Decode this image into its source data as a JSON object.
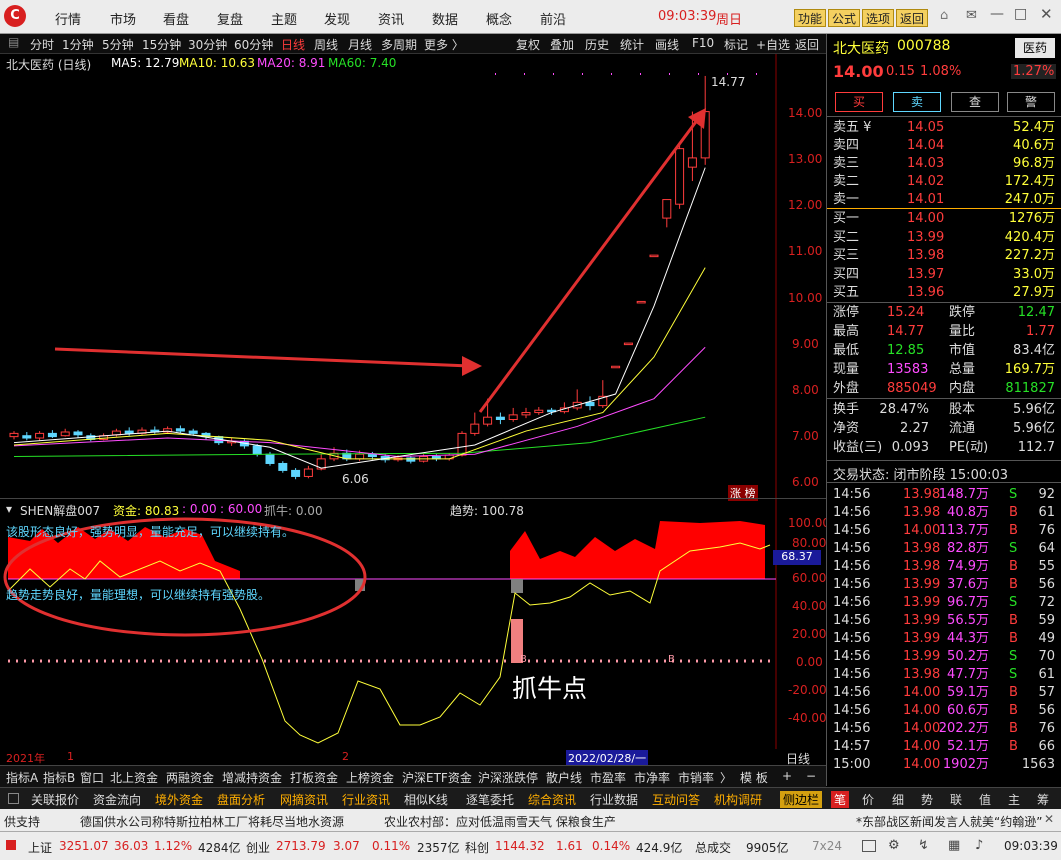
{
  "topbar": {
    "logo": "C",
    "menu": [
      "行情",
      "市场",
      "看盘",
      "复盘",
      "主题",
      "发现",
      "资讯",
      "数据",
      "概念",
      "前沿"
    ],
    "time": "09:03:39",
    "weekday": "周日",
    "buttons": [
      "功能",
      "公式",
      "选项",
      "返回"
    ]
  },
  "periodbar": {
    "periods": [
      "分时",
      "1分钟",
      "5分钟",
      "15分钟",
      "30分钟",
      "60分钟",
      "日线",
      "周线",
      "月线",
      "多周期",
      "更多 〉"
    ],
    "active": "日线",
    "tools": [
      "复权",
      "叠加",
      "历史",
      "统计",
      "画线",
      "F10",
      "标记",
      "+自选",
      "返回"
    ]
  },
  "mainchart": {
    "title": "北大医药 (日线)",
    "ma": [
      "MA5: 12.79",
      "MA10: 10.63",
      "MA20: 8.91",
      "MA60: 7.40"
    ],
    "high_label": "14.77",
    "low_label": "6.06",
    "badge": "涨 榜",
    "annotation": "抓牛点",
    "y_ticks": [
      "14.00",
      "13.00",
      "12.00",
      "11.00",
      "10.00",
      "9.00",
      "8.00",
      "7.00",
      "6.00"
    ]
  },
  "indicator": {
    "name": "SHEN解盘007",
    "fund": "资金: 80.83",
    "v1": ": 0.00",
    "v2": ": 60.00",
    "bull": "抓牛: 0.00",
    "trend": "趋势: 100.78",
    "msg1": "该股形态良好，强势明显，量能充足，可以继续持有。",
    "msg2": "趋势走势良好，量能理想，可以继续持有强势股。",
    "current_value": "68.37",
    "b_label": "B",
    "y_ticks": [
      "100.00",
      "80.00",
      "60.00",
      "40.00",
      "20.00",
      "0.00",
      "-20.00",
      "-40.00"
    ],
    "date_left": "2021年",
    "date_mid": "2",
    "date_right": "2022/02/28/一",
    "period": "日线"
  },
  "stock": {
    "name": "北大医药",
    "code": "000788",
    "sector": "医药",
    "price": "14.00",
    "change": "0.15",
    "pct": "1.08%",
    "sector_pct": "1.27%",
    "actions": [
      "买",
      "卖",
      "查",
      "警"
    ]
  },
  "orderbook": {
    "asks": [
      {
        "label": "卖五 ¥",
        "price": "14.05",
        "vol": "52.4万"
      },
      {
        "label": "卖四",
        "price": "14.04",
        "vol": "40.6万"
      },
      {
        "label": "卖三",
        "price": "14.03",
        "vol": "96.8万"
      },
      {
        "label": "卖二",
        "price": "14.02",
        "vol": "172.4万"
      },
      {
        "label": "卖一",
        "price": "14.01",
        "vol": "247.0万"
      }
    ],
    "bids": [
      {
        "label": "买一",
        "price": "14.00",
        "vol": "1276万"
      },
      {
        "label": "买二",
        "price": "13.99",
        "vol": "420.4万"
      },
      {
        "label": "买三",
        "price": "13.98",
        "vol": "227.2万"
      },
      {
        "label": "买四",
        "price": "13.97",
        "vol": "33.0万"
      },
      {
        "label": "买五",
        "price": "13.96",
        "vol": "27.9万"
      }
    ]
  },
  "quote": [
    {
      "l1": "涨停",
      "v1": "15.24",
      "l2": "跌停",
      "v2": "12.47"
    },
    {
      "l1": "最高",
      "v1": "14.77",
      "l2": "量比",
      "v2": "1.77"
    },
    {
      "l1": "最低",
      "v1": "12.85",
      "l2": "市值",
      "v2": "83.4亿"
    },
    {
      "l1": "现量",
      "v1": "13583",
      "l2": "总量",
      "v2": "169.7万"
    },
    {
      "l1": "外盘",
      "v1": "885049",
      "l2": "内盘",
      "v2": "811827"
    }
  ],
  "stats": [
    {
      "l1": "换手",
      "v1": "28.47%",
      "l2": "股本",
      "v2": "5.96亿"
    },
    {
      "l1": "净资",
      "v1": "2.27",
      "l2": "流通",
      "v2": "5.96亿"
    },
    {
      "l1": "收益(三)",
      "v1": "0.093",
      "l2": "PE(动)",
      "v2": "112.7"
    }
  ],
  "trade_status": "交易状态: 闭市阶段 15:00:03",
  "ticks": [
    {
      "t": "14:56",
      "p": "13.98",
      "v": "148.7万",
      "s": "S",
      "n": "92"
    },
    {
      "t": "14:56",
      "p": "13.98",
      "v": "40.8万",
      "s": "B",
      "n": "61"
    },
    {
      "t": "14:56",
      "p": "14.00",
      "v": "113.7万",
      "s": "B",
      "n": "76"
    },
    {
      "t": "14:56",
      "p": "13.98",
      "v": "82.8万",
      "s": "S",
      "n": "64"
    },
    {
      "t": "14:56",
      "p": "13.98",
      "v": "74.9万",
      "s": "B",
      "n": "55"
    },
    {
      "t": "14:56",
      "p": "13.99",
      "v": "37.6万",
      "s": "B",
      "n": "56"
    },
    {
      "t": "14:56",
      "p": "13.99",
      "v": "96.7万",
      "s": "S",
      "n": "72"
    },
    {
      "t": "14:56",
      "p": "13.99",
      "v": "56.5万",
      "s": "B",
      "n": "59"
    },
    {
      "t": "14:56",
      "p": "13.99",
      "v": "44.3万",
      "s": "B",
      "n": "49"
    },
    {
      "t": "14:56",
      "p": "13.99",
      "v": "50.2万",
      "s": "S",
      "n": "70"
    },
    {
      "t": "14:56",
      "p": "13.98",
      "v": "47.7万",
      "s": "S",
      "n": "61"
    },
    {
      "t": "14:56",
      "p": "14.00",
      "v": "59.1万",
      "s": "B",
      "n": "57"
    },
    {
      "t": "14:56",
      "p": "14.00",
      "v": "60.6万",
      "s": "B",
      "n": "56"
    },
    {
      "t": "14:56",
      "p": "14.00",
      "v": "202.2万",
      "s": "B",
      "n": "76"
    },
    {
      "t": "14:57",
      "p": "14.00",
      "v": "52.1万",
      "s": "B",
      "n": "66"
    },
    {
      "t": "15:00",
      "p": "14.00",
      "v": "1902万",
      "s": "",
      "n": "1563"
    }
  ],
  "bottomtabs": [
    "指标A",
    "指标B",
    "窗口",
    "北上资金",
    "两融资金",
    "增减持资金",
    "打板资金",
    "上榜资金",
    "沪深ETF资金",
    "沪深涨跌停",
    "散户线",
    "市盈率",
    "市净率",
    "市销率",
    "〉",
    "模 板",
    "+",
    "−"
  ],
  "bottomtabs2": [
    "关联报价",
    "资金流向",
    "境外资金",
    "盘面分析",
    "网摘资讯",
    "行业资讯",
    "相似K线",
    "逐笔委托",
    "综合资讯",
    "行业数据",
    "互动问答",
    "机构调研",
    "侧边栏"
  ],
  "rightmini": [
    "笔",
    "价",
    "细",
    "势",
    "联",
    "值",
    "主",
    "筹"
  ],
  "news": {
    "left": "供支持",
    "items": [
      "德国供水公司称特斯拉柏林工厂将耗尽当地水资源",
      "农业农村部：应对低温雨雪天气 保粮食生产"
    ],
    "right": "*东部战区新闻发言人就美“约翰逊”"
  },
  "statusbar": {
    "sh_label": "上证",
    "sh": "3251.07",
    "sh_chg": "36.03",
    "sh_pct": "1.12%",
    "sh_amt": "4284亿",
    "cy_label": "创业",
    "cy": "2713.79",
    "cy_chg": "3.07",
    "cy_pct": "0.11%",
    "cy_amt": "2357亿",
    "kc_label": "科创",
    "kc": "1144.32",
    "kc_chg": "1.61",
    "kc_pct": "0.14%",
    "kc_amt": "424.9亿",
    "total_label": "总成交",
    "total": "9905亿",
    "mode": "7x24",
    "clock": "09:03:39"
  },
  "colors": {
    "up": "#ff3c3c",
    "down": "#26e026",
    "ma5": "#ffffff",
    "ma10": "#ffff3a",
    "ma20": "#ff4cff",
    "ma60": "#26e026",
    "accent": "#d82020"
  }
}
